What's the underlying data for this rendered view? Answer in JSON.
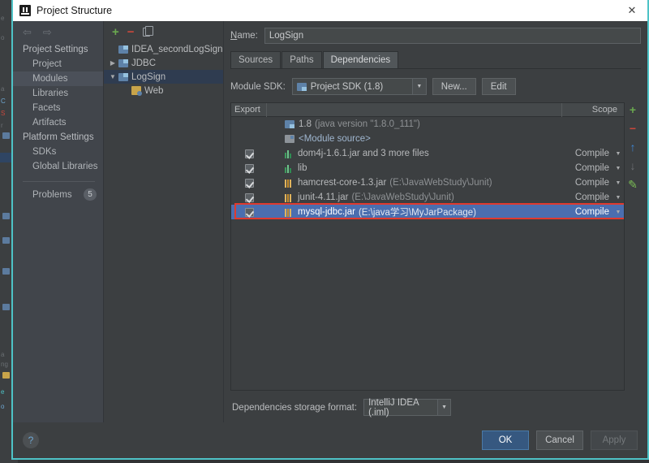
{
  "window": {
    "title": "Project Structure",
    "close_label": "✕",
    "app_icon": "intellij-idea-icon"
  },
  "sidebar": {
    "nav_back": "⇦",
    "nav_forward": "⇨",
    "groups": [
      {
        "label": "Project Settings",
        "items": [
          {
            "label": "Project",
            "selected": false
          },
          {
            "label": "Modules",
            "selected": true
          },
          {
            "label": "Libraries",
            "selected": false
          },
          {
            "label": "Facets",
            "selected": false
          },
          {
            "label": "Artifacts",
            "selected": false
          }
        ]
      },
      {
        "label": "Platform Settings",
        "items": [
          {
            "label": "SDKs",
            "selected": false
          },
          {
            "label": "Global Libraries",
            "selected": false
          }
        ]
      }
    ],
    "problems": {
      "label": "Problems",
      "count": "5"
    }
  },
  "tree": {
    "toolbar": {
      "add": "+",
      "remove": "−",
      "copy": "copy-icon"
    },
    "nodes": [
      {
        "label": "IDEA_secondLogSign",
        "twisty": "",
        "indent": 1,
        "icon": "module-icon",
        "selected": false
      },
      {
        "label": "JDBC",
        "twisty": "▶",
        "indent": 0,
        "icon": "module-icon",
        "selected": false
      },
      {
        "label": "LogSign",
        "twisty": "▼",
        "indent": 0,
        "icon": "module-icon",
        "selected": true
      },
      {
        "label": "Web",
        "twisty": "",
        "indent": 2,
        "icon": "web-facet-icon",
        "selected": false
      }
    ]
  },
  "main": {
    "name_label": "Name:",
    "name_value": "LogSign",
    "tabs": [
      {
        "label": "Sources",
        "active": false
      },
      {
        "label": "Paths",
        "active": false
      },
      {
        "label": "Dependencies",
        "active": true
      }
    ],
    "sdk_label": "Module SDK:",
    "sdk_value": "Project SDK (1.8)",
    "sdk_new_button": "New...",
    "sdk_edit_button": "Edit",
    "storage_label": "Dependencies storage format:",
    "storage_value": "IntelliJ IDEA (.iml)"
  },
  "table": {
    "headers": {
      "export": "Export",
      "scope": "Scope"
    },
    "rows": [
      {
        "checkbox": "none",
        "icon": "jdk-icon",
        "name": "1.8",
        "detail": "(java version \"1.8.0_111\")",
        "scope": "",
        "selected": false,
        "annotated": false
      },
      {
        "checkbox": "none",
        "icon": "module-source-icon",
        "name": "<Module source>",
        "detail": "",
        "scope": "",
        "selected": false,
        "annotated": false
      },
      {
        "checkbox": "checked",
        "icon": "library-group-icon",
        "name": "dom4j-1.6.1.jar and 3 more files",
        "detail": "",
        "scope": "Compile",
        "selected": false,
        "annotated": false
      },
      {
        "checkbox": "checked",
        "icon": "library-group-icon",
        "name": "lib",
        "detail": "",
        "scope": "Compile",
        "selected": false,
        "annotated": false
      },
      {
        "checkbox": "checked",
        "icon": "jar-icon",
        "name": "hamcrest-core-1.3.jar",
        "detail": "(E:\\JavaWebStudy\\Junit)",
        "scope": "Compile",
        "selected": false,
        "annotated": false
      },
      {
        "checkbox": "checked",
        "icon": "jar-icon",
        "name": "junit-4.11.jar",
        "detail": "(E:\\JavaWebStudy\\Junit)",
        "scope": "Compile",
        "selected": false,
        "annotated": false
      },
      {
        "checkbox": "checked",
        "icon": "jar-icon",
        "name": "mysql-jdbc.jar",
        "detail": "(E:\\java学习\\MyJarPackage)",
        "scope": "Compile",
        "selected": true,
        "annotated": true
      }
    ],
    "toolbar": [
      {
        "name": "add-dependency",
        "glyph": "+",
        "kind": "plus"
      },
      {
        "name": "remove-dependency",
        "glyph": "−",
        "kind": "minus"
      },
      {
        "name": "move-up",
        "glyph": "↑",
        "kind": "up"
      },
      {
        "name": "move-down",
        "glyph": "↓",
        "kind": "down"
      },
      {
        "name": "edit-dependency",
        "glyph": "✎",
        "kind": "edit"
      }
    ]
  },
  "footer": {
    "help": "?",
    "ok": "OK",
    "cancel": "Cancel",
    "apply": "Apply"
  },
  "colors": {
    "dialog_border": "#4ec3c7",
    "selection_blue": "#4b6eaf",
    "annotation_red": "#e03a2f",
    "primary_button": "#365880",
    "add_green": "#6aa84f",
    "remove_red": "#c9483c"
  }
}
